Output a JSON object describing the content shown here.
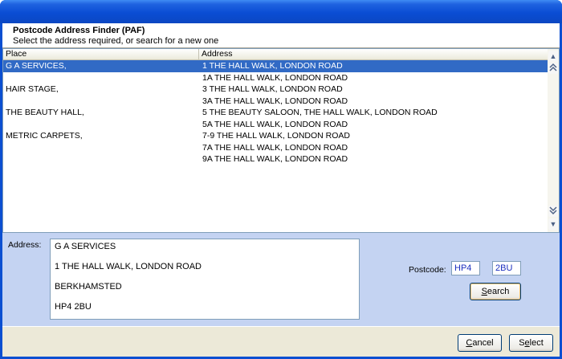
{
  "header": {
    "title": "Postcode Address Finder (PAF)",
    "subtitle": "Select the address required, or search for a new one"
  },
  "list": {
    "columns": {
      "place": "Place",
      "address": "Address"
    },
    "rows": [
      {
        "place": "G A SERVICES,",
        "address": "1 THE HALL WALK, LONDON ROAD",
        "selected": true
      },
      {
        "place": "",
        "address": "1A THE HALL WALK, LONDON ROAD"
      },
      {
        "place": "HAIR STAGE,",
        "address": "3 THE HALL WALK, LONDON ROAD"
      },
      {
        "place": "",
        "address": "3A THE HALL WALK, LONDON ROAD"
      },
      {
        "place": "THE BEAUTY HALL,",
        "address": "5 THE BEAUTY SALOON, THE HALL WALK, LONDON ROAD"
      },
      {
        "place": "",
        "address": "5A THE HALL WALK, LONDON ROAD"
      },
      {
        "place": "METRIC CARPETS,",
        "address": "7-9 THE HALL WALK, LONDON ROAD"
      },
      {
        "place": "",
        "address": "7A THE HALL WALK, LONDON ROAD"
      },
      {
        "place": "",
        "address": "9A THE HALL WALK, LONDON ROAD"
      }
    ]
  },
  "address": {
    "label": "Address:",
    "lines": [
      "G A SERVICES",
      "1 THE HALL WALK, LONDON ROAD",
      "BERKHAMSTED",
      "HP4 2BU"
    ]
  },
  "postcode": {
    "label": "Postcode:",
    "part1": "HP4",
    "part2": "2BU"
  },
  "buttons": {
    "search": {
      "mnemonic": "S",
      "rest": "earch"
    },
    "cancel": {
      "mnemonic": "C",
      "rest": "ancel"
    },
    "select": {
      "mnemonic": "",
      "pre": "S",
      "u": "e",
      "post": "lect"
    }
  },
  "icons": {
    "scroll_up": "double-chevron-up-icon",
    "scroll_down": "double-chevron-down-icon"
  },
  "colors": {
    "selection": "#316ac5",
    "panel": "#c4d3f2",
    "postcode_text": "#1b2fbf"
  }
}
